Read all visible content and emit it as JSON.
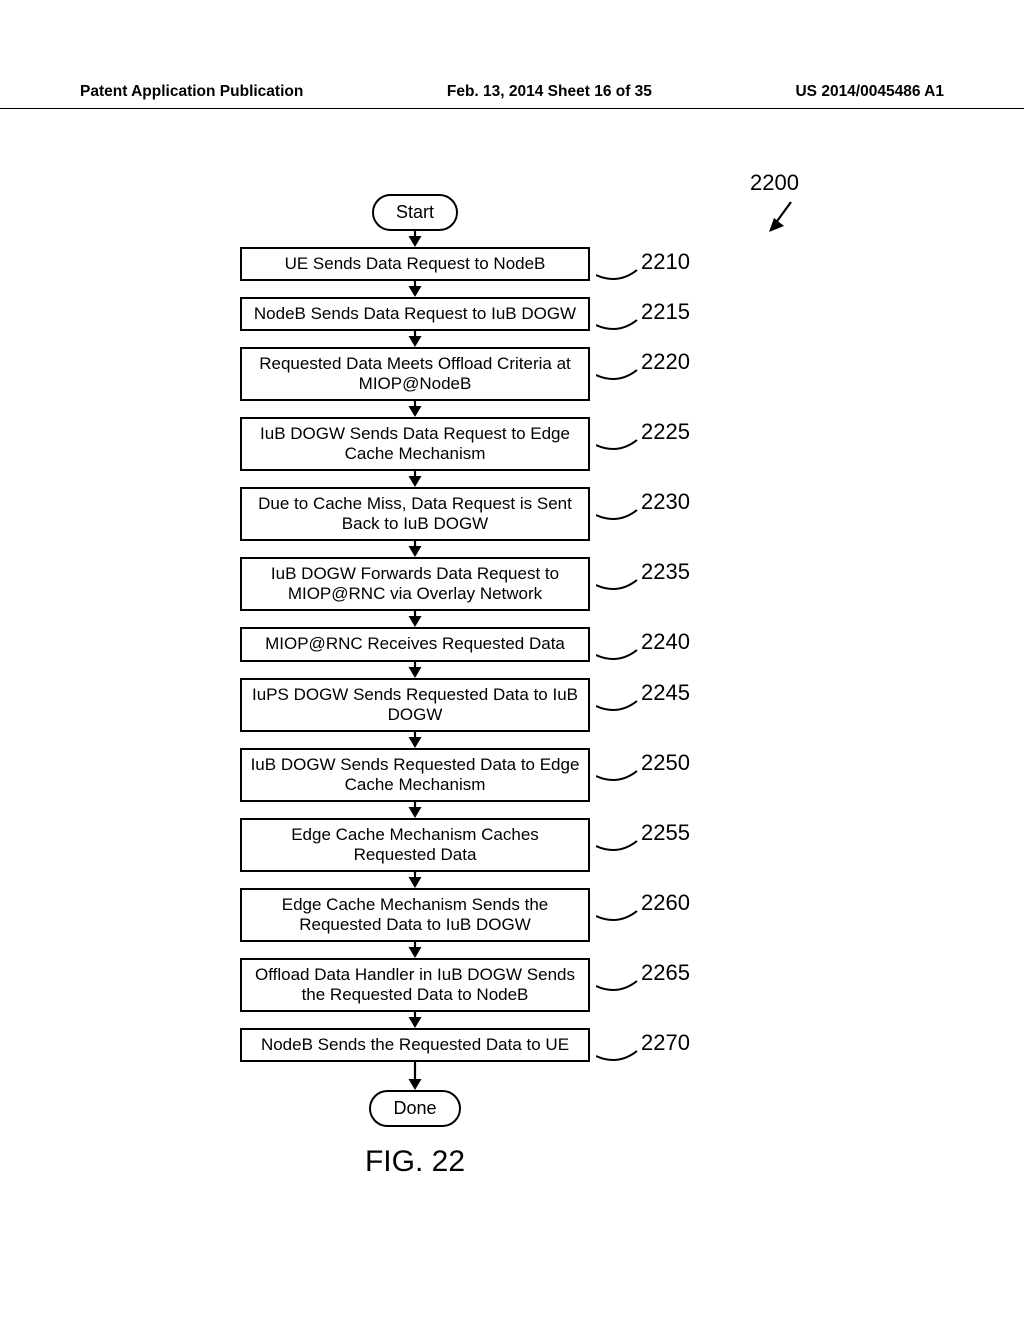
{
  "header": {
    "left": "Patent Application Publication",
    "center": "Feb. 13, 2014  Sheet 16 of 35",
    "right": "US 2014/0045486 A1"
  },
  "figure": {
    "ref": "2200",
    "title": "FIG. 22",
    "start": "Start",
    "done": "Done",
    "steps": [
      {
        "text": "UE Sends Data Request to NodeB",
        "num": "2210"
      },
      {
        "text": "NodeB Sends Data Request to IuB DOGW",
        "num": "2215"
      },
      {
        "text": "Requested Data Meets Offload Criteria at MIOP@NodeB",
        "num": "2220"
      },
      {
        "text": "IuB DOGW Sends Data Request to Edge Cache Mechanism",
        "num": "2225"
      },
      {
        "text": "Due to Cache Miss, Data Request is Sent Back to IuB DOGW",
        "num": "2230"
      },
      {
        "text": "IuB DOGW Forwards Data Request to MIOP@RNC via Overlay Network",
        "num": "2235"
      },
      {
        "text": "MIOP@RNC Receives Requested Data",
        "num": "2240"
      },
      {
        "text": "IuPS DOGW Sends Requested Data to IuB DOGW",
        "num": "2245"
      },
      {
        "text": "IuB DOGW Sends Requested Data to Edge Cache Mechanism",
        "num": "2250"
      },
      {
        "text": "Edge Cache Mechanism Caches Requested Data",
        "num": "2255"
      },
      {
        "text": "Edge Cache Mechanism Sends the Requested Data to IuB DOGW",
        "num": "2260"
      },
      {
        "text": "Offload Data Handler in IuB DOGW Sends the Requested Data to NodeB",
        "num": "2265"
      },
      {
        "text": "NodeB Sends the Requested Data to UE",
        "num": "2270"
      }
    ]
  }
}
